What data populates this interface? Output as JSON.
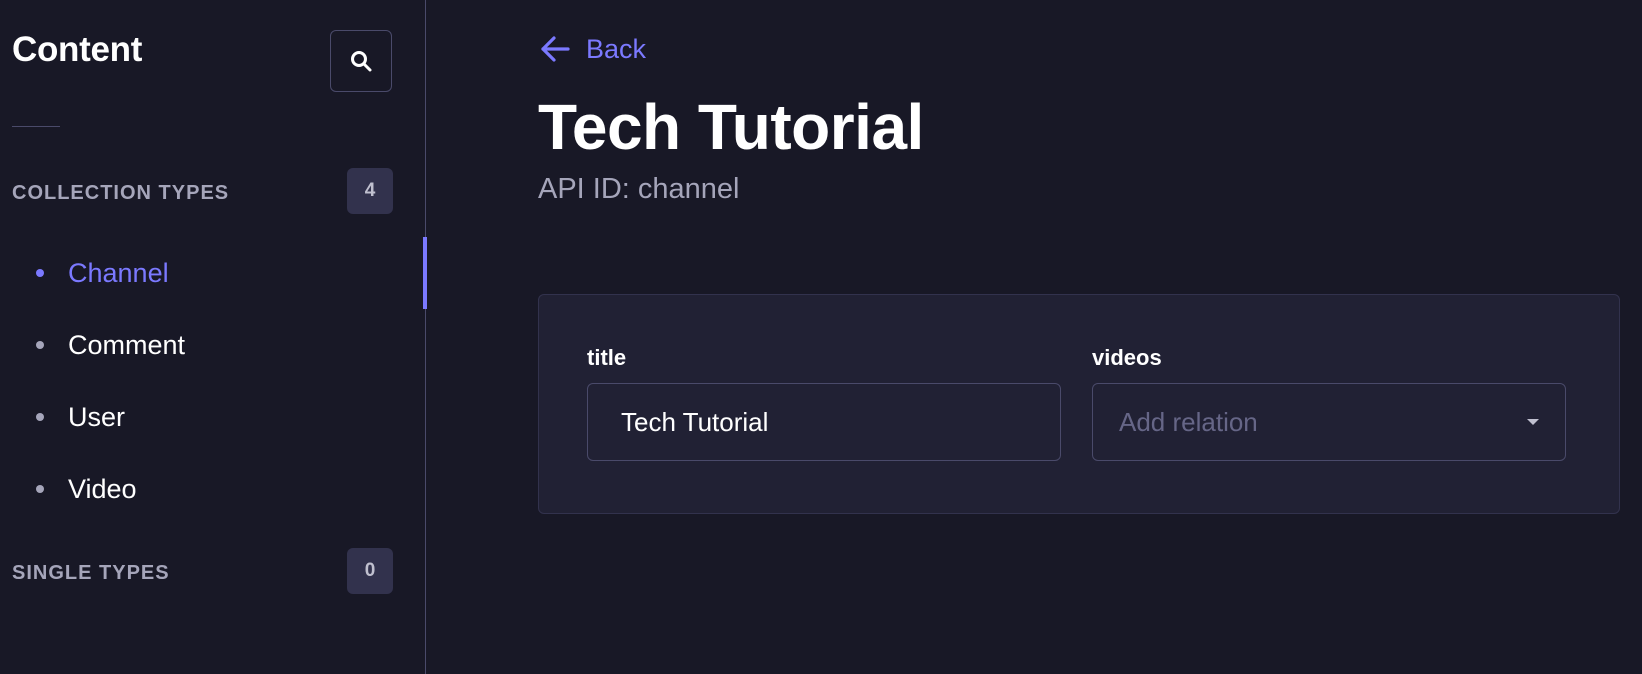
{
  "sidebar": {
    "title": "Content",
    "search_icon": "search-icon",
    "collection_types": {
      "label": "Collection Types",
      "count": "4",
      "items": [
        {
          "label": "Channel",
          "active": true
        },
        {
          "label": "Comment",
          "active": false
        },
        {
          "label": "User",
          "active": false
        },
        {
          "label": "Video",
          "active": false
        }
      ]
    },
    "single_types": {
      "label": "Single Types",
      "count": "0"
    }
  },
  "main": {
    "back_label": "Back",
    "title": "Tech Tutorial",
    "subtitle": "API ID: channel",
    "fields": {
      "title": {
        "label": "title",
        "value": "Tech Tutorial"
      },
      "videos": {
        "label": "videos",
        "placeholder": "Add relation"
      }
    }
  },
  "colors": {
    "background": "#181826",
    "card": "#212134",
    "accent": "#7b79ff",
    "muted": "#a5a5ba",
    "border": "#4a4a6a"
  }
}
